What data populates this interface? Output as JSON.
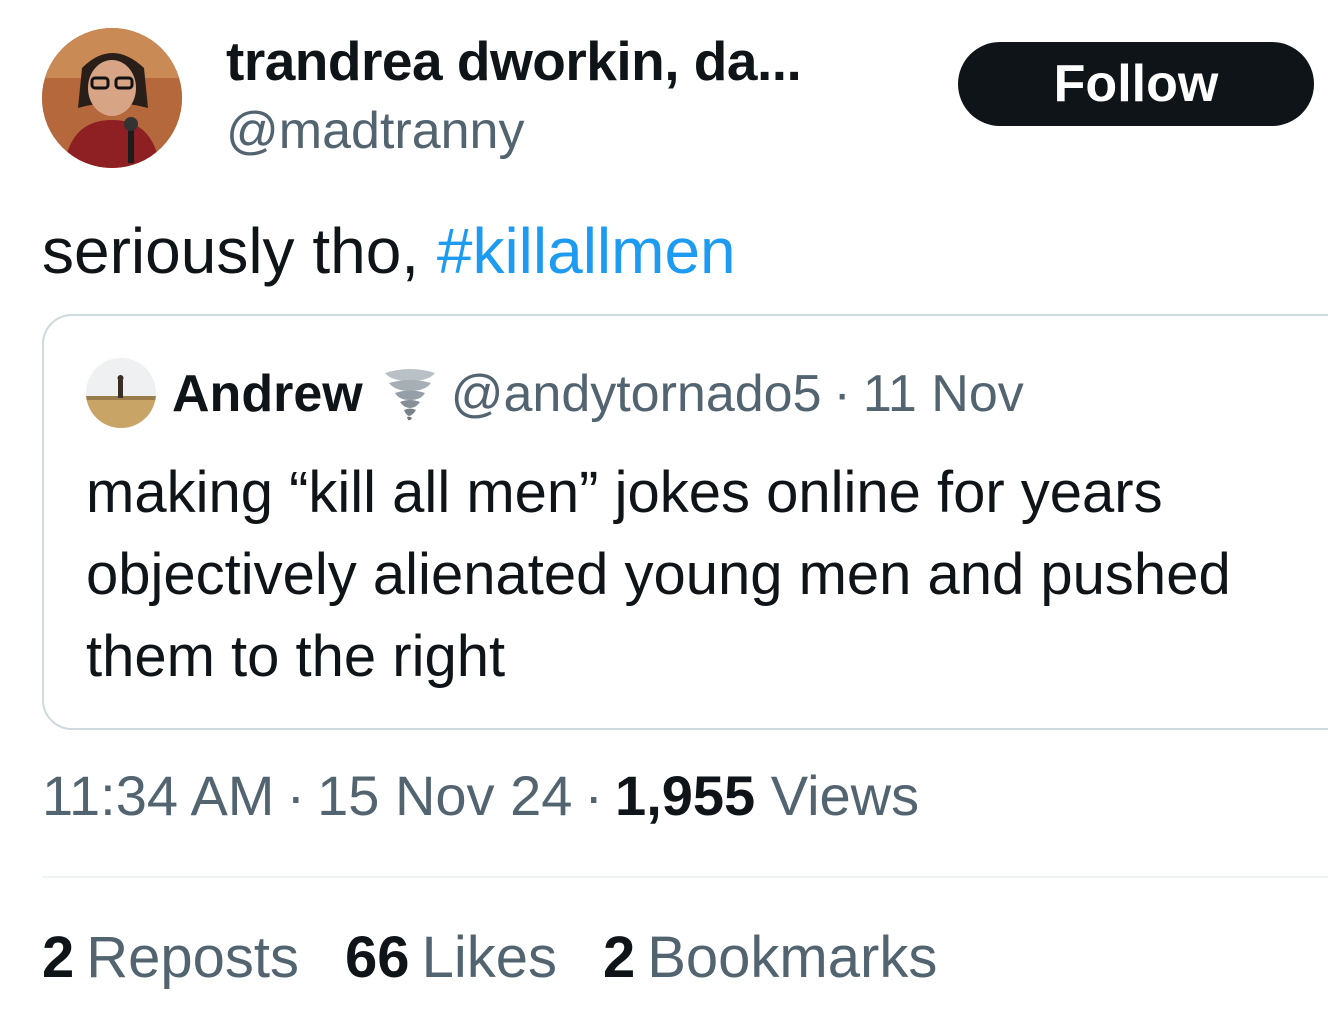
{
  "author": {
    "display_name": "trandrea dworkin, da...",
    "handle": "@madtranny"
  },
  "follow_button": {
    "label": "Follow"
  },
  "tweet": {
    "text_prefix": "seriously tho, ",
    "hashtag": "#killallmen"
  },
  "quote": {
    "name": "Andrew",
    "badge_icon": "tornado-emoji",
    "handle": "@andytornado5",
    "separator": "·",
    "date": "11 Nov",
    "text": "making “kill all men” jokes online for years objectively alienated young men and pushed them to the right"
  },
  "meta": {
    "time": "11:34 AM",
    "date": "15 Nov 24",
    "separator": "·",
    "views_count": "1,955",
    "views_label": "Views"
  },
  "stats": {
    "reposts_count": "2",
    "reposts_label": "Reposts",
    "likes_count": "66",
    "likes_label": "Likes",
    "bookmarks_count": "2",
    "bookmarks_label": "Bookmarks"
  },
  "colors": {
    "text": "#0f1419",
    "secondary": "#536471",
    "link": "#1d9bf0",
    "border": "#cfd9de",
    "button_bg": "#0f1419"
  }
}
